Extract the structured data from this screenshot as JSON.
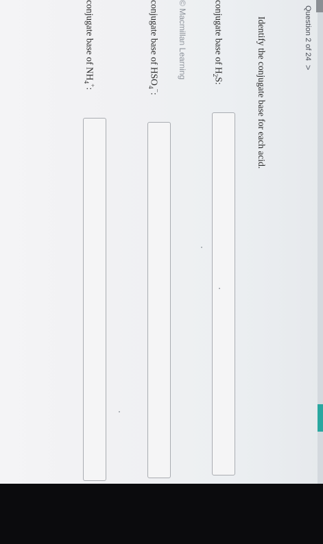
{
  "header": {
    "question_counter": "Question 2 of 24",
    "next_icon": "chevron-right-icon",
    "next_glyph": ">"
  },
  "copyright": "© Macmillan Learning",
  "prompt": "Identify the conjugate base for each acid.",
  "rows": [
    {
      "prefix": "conjugate base of H",
      "sub": "2",
      "mid": "S",
      "sup": "",
      "suffix": ":"
    },
    {
      "prefix": "conjugate base of HSO",
      "sub": "4",
      "mid": "",
      "sup": "−",
      "suffix": ":"
    },
    {
      "prefix": "conjugate base of NH",
      "sub": "4",
      "mid": "",
      "sup": "+",
      "suffix": ":"
    }
  ],
  "inputs": [
    "",
    "",
    ""
  ],
  "colors": {
    "accent": "#2aa7a0"
  }
}
